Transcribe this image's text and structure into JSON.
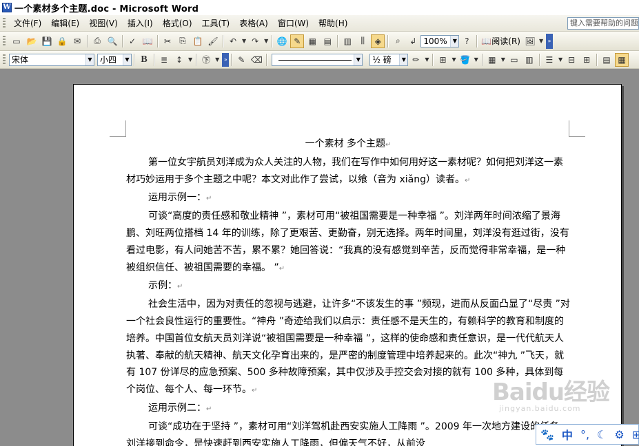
{
  "window": {
    "title": "一个素材多个主题.doc - Microsoft Word"
  },
  "menu": {
    "items": [
      "文件(F)",
      "编辑(E)",
      "视图(V)",
      "插入(I)",
      "格式(O)",
      "工具(T)",
      "表格(A)",
      "窗口(W)",
      "帮助(H)"
    ],
    "help_placeholder": "键入需要帮助的问题"
  },
  "toolbar": {
    "zoom": "100%",
    "read_label": "阅读(R)",
    "font": "宋体",
    "size": "小四",
    "bold_label": "B",
    "line_weight": "½ 磅"
  },
  "document": {
    "title": "一个素材 多个主题",
    "paragraphs": [
      "第一位女宇航员刘洋成为众人关注的人物，我们在写作中如何用好这一素材呢？如何把刘洋这一素材巧妙运用于多个主题之中呢？本文对此作了尝试，以飨（音为 xiǎng）读者。",
      "运用示例一：",
      "可谈“高度的责任感和敬业精神 ”，素材可用“被祖国需要是一种幸福 ”。刘洋两年时间浓缩了景海鹏、刘旺两位搭档 14 年的训练，除了更艰苦、更勤奋，别无选择。两年时间里，刘洋没有逛过街，没有看过电影，有人问她苦不苦，累不累？她回答说：“我真的没有感觉到辛苦，反而觉得非常幸福，是一种被组织信任、被祖国需要的幸福。 ”",
      "示例：",
      "社会生活中，因为对责任的忽视与逃避，让许多“不该发生的事 ”频现，进而从反面凸显了“尽责 ”对一个社会良性运行的重要性。“神舟 ”奇迹给我们以启示：责任感不是天生的，有赖科学的教育和制度的培养。中国首位女航天员刘洋说“被祖国需要是一种幸福 ”，这样的使命感和责任意识，是一代代航天人执著、奉献的航天精神、航天文化孕育出来的，是严密的制度管理中培养起来的。此次“神九 ”飞天，就有 107 份详尽的应急预案、500 多种故障预案，其中仅涉及手控交会对接的就有 100 多种，具体到每个岗位、每个人、每一环节。",
      "运用示例二：",
      "可谈“成功在于坚持 ”，素材可用“刘洋驾机赴西安实施人工降雨 ”。2009 年一次地方建设的任务，刘洋接到命令，是快速赶到西安实施人工降雨，但偏天气不好，从前没"
    ]
  },
  "watermark": {
    "brand": "Baidu经验",
    "url": "jingyan.baidu.com"
  },
  "ime": {
    "lang": "中"
  }
}
